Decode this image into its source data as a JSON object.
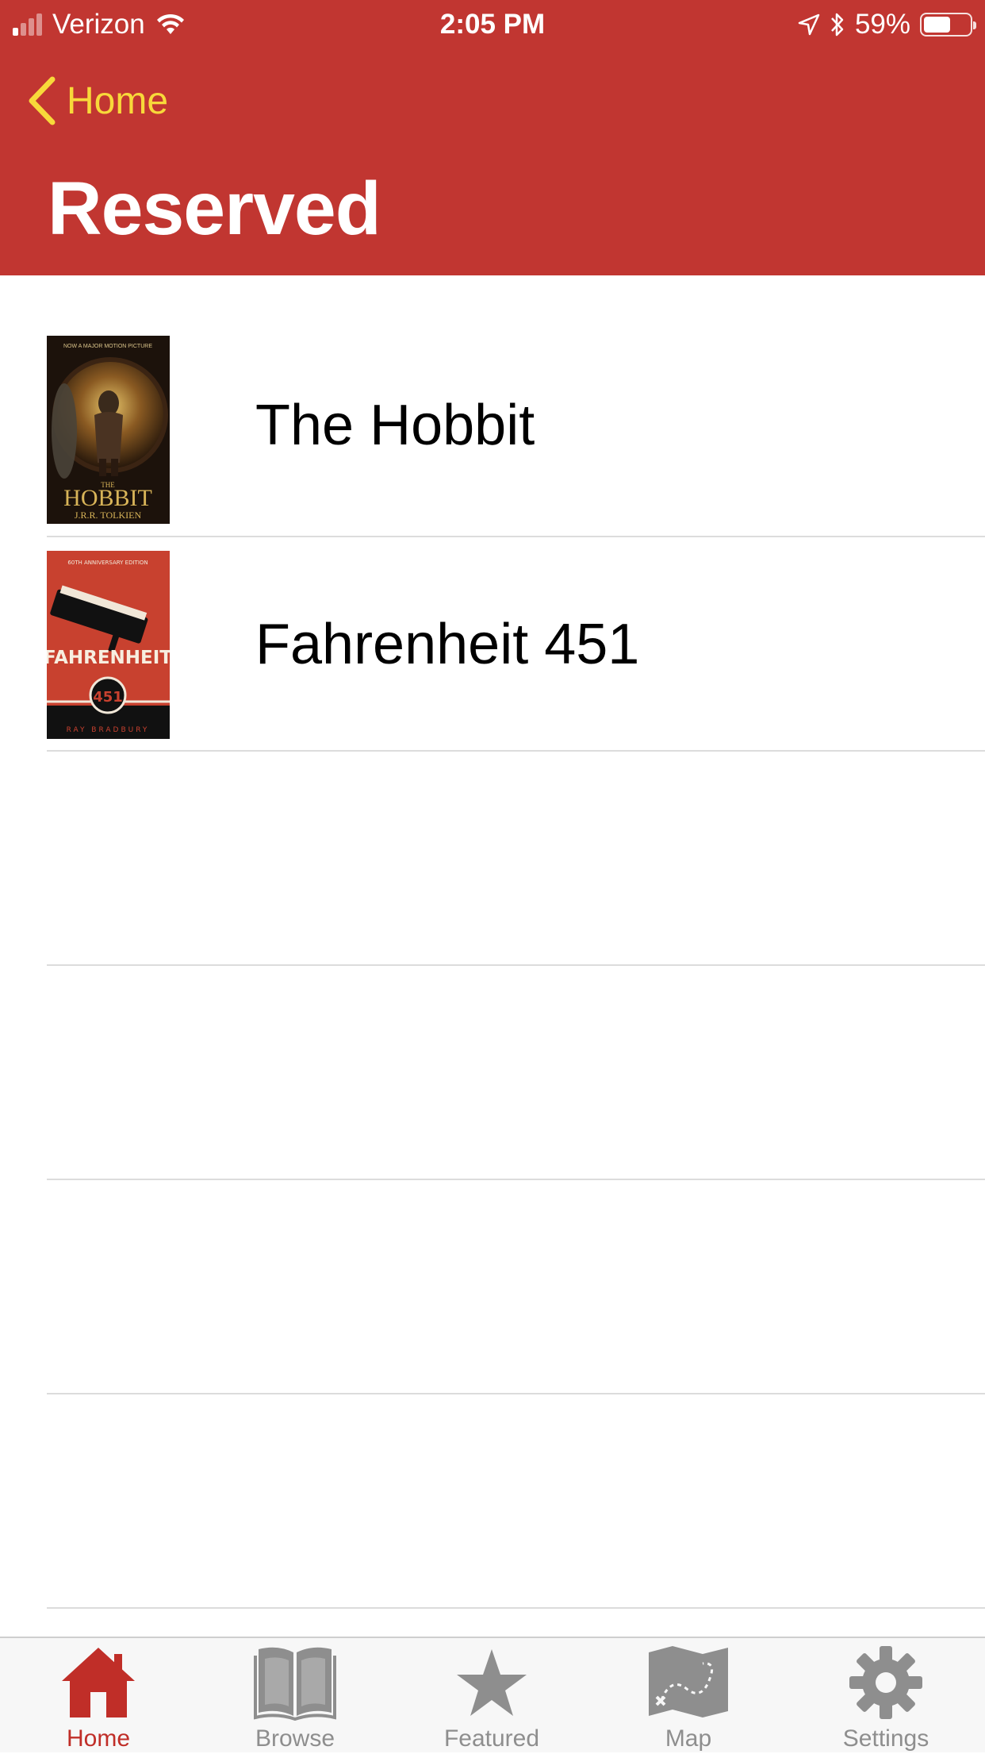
{
  "status_bar": {
    "carrier": "Verizon",
    "time": "2:05 PM",
    "battery_percent": "59%",
    "battery_level": 0.59,
    "signal_bars_on": 1,
    "signal_bars_total": 4,
    "icons": [
      "signal-icon",
      "wifi-icon",
      "location-arrow-icon",
      "bluetooth-icon",
      "battery-icon"
    ]
  },
  "nav": {
    "back_label": "Home",
    "title": "Reserved"
  },
  "books": [
    {
      "title": "The Hobbit",
      "cover": "hobbit-cover",
      "cover_top": "NOW A MAJOR MOTION PICTURE",
      "cover_sub": "THE",
      "cover_main": "HOBBIT",
      "cover_author": "J.R.R. TOLKIEN"
    },
    {
      "title": "Fahrenheit 451",
      "cover": "fahrenheit-cover",
      "cover_top": "60TH ANNIVERSARY EDITION",
      "cover_main": "FAHRENHEIT",
      "cover_num": "451",
      "cover_author": "RAY BRADBURY"
    }
  ],
  "tabs": [
    {
      "label": "Home",
      "icon": "home-icon",
      "active": true
    },
    {
      "label": "Browse",
      "icon": "book-icon",
      "active": false
    },
    {
      "label": "Featured",
      "icon": "star-icon",
      "active": false
    },
    {
      "label": "Map",
      "icon": "map-icon",
      "active": false
    },
    {
      "label": "Settings",
      "icon": "gear-icon",
      "active": false
    }
  ],
  "colors": {
    "header_bg": "#c13631",
    "back_tint": "#f8d93a",
    "tab_active": "#c02e28",
    "tab_inactive": "#8e8e8e"
  }
}
